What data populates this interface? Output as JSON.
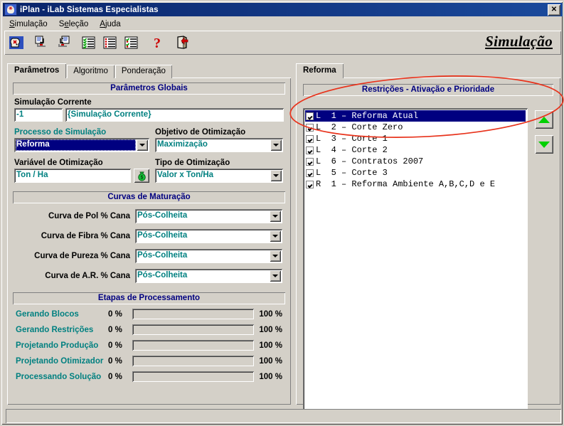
{
  "window": {
    "title": "iPlan - iLab Sistemas Especialistas",
    "icon": "app-head-icon",
    "close_label": "✕",
    "brand": "Simulação",
    "statusbar_text": ""
  },
  "menubar": {
    "items": [
      {
        "label": "Simulação",
        "accel": "S"
      },
      {
        "label": "Seleção",
        "accel": "e"
      },
      {
        "label": "Ajuda",
        "accel": "A"
      }
    ]
  },
  "toolbar": {
    "buttons": [
      {
        "name": "new-simulation-icon",
        "title": "Nova Simulação"
      },
      {
        "name": "import-icon",
        "title": "Importar"
      },
      {
        "name": "export-icon",
        "title": "Exportar"
      },
      {
        "name": "list-check-green-icon",
        "title": "Lista Ativada"
      },
      {
        "name": "list-bullets-icon",
        "title": "Lista"
      },
      {
        "name": "list-check-mixed-icon",
        "title": "Lista Mista"
      },
      {
        "name": "help-question-icon",
        "title": "Ajuda"
      },
      {
        "name": "exit-door-icon",
        "title": "Sair"
      }
    ]
  },
  "left": {
    "tabs": [
      {
        "label": "Parâmetros",
        "active": true
      },
      {
        "label": "Algoritmo",
        "active": false
      },
      {
        "label": "Ponderação",
        "active": false
      }
    ],
    "group_globais": "Parâmetros Globais",
    "simulacao_corrente_label": "Simulação Corrente",
    "simulacao_corrente_id": "-1",
    "simulacao_corrente_nome": "{Simulação Corrente}",
    "processo_label": "Processo de Simulação",
    "processo_value": "Reforma",
    "objetivo_label": "Objetivo de Otimização",
    "objetivo_value": "Maximização",
    "variavel_label": "Variável de Otimização",
    "variavel_value": "Ton / Ha",
    "variavel_icon": "money-bag-icon",
    "tipo_label": "Tipo de Otimização",
    "tipo_value": "Valor x Ton/Ha",
    "group_curvas": "Curvas de Maturação",
    "curvas": [
      {
        "label": "Curva de Pol % Cana",
        "value": "Pós-Colheita"
      },
      {
        "label": "Curva de Fibra % Cana",
        "value": "Pós-Colheita"
      },
      {
        "label": "Curva de Pureza % Cana",
        "value": "Pós-Colheita"
      },
      {
        "label": "Curva de A.R. % Cana",
        "value": "Pós-Colheita"
      }
    ],
    "group_etapas": "Etapas de Processamento",
    "etapas": [
      {
        "label": "Gerando Blocos",
        "min": "0 %",
        "max": "100 %",
        "progress": 0
      },
      {
        "label": "Gerando Restrições",
        "min": "0 %",
        "max": "100 %",
        "progress": 0
      },
      {
        "label": "Projetando Produção",
        "min": "0 %",
        "max": "100 %",
        "progress": 0
      },
      {
        "label": "Projetando Otimizador",
        "min": "0 %",
        "max": "100 %",
        "progress": 0
      },
      {
        "label": "Processando Solução",
        "min": "0 %",
        "max": "100 %",
        "progress": 0
      }
    ]
  },
  "right": {
    "tabs": [
      {
        "label": "Reforma",
        "active": true
      }
    ],
    "group_restricoes": "Restrições - Ativação e Prioridade",
    "restricoes": [
      {
        "checked": true,
        "tipo": "L",
        "num": "1",
        "nome": "Reforma Atual",
        "selected": true
      },
      {
        "checked": true,
        "tipo": "L",
        "num": "2",
        "nome": "Corte Zero",
        "selected": false
      },
      {
        "checked": true,
        "tipo": "L",
        "num": "3",
        "nome": "Corte 1",
        "selected": false
      },
      {
        "checked": true,
        "tipo": "L",
        "num": "4",
        "nome": "Corte 2",
        "selected": false
      },
      {
        "checked": true,
        "tipo": "L",
        "num": "6",
        "nome": "Contratos 2007",
        "selected": false
      },
      {
        "checked": true,
        "tipo": "L",
        "num": "5",
        "nome": "Corte 3",
        "selected": false
      },
      {
        "checked": true,
        "tipo": "R",
        "num": "1",
        "nome": "Reforma Ambiente A,B,C,D e E",
        "selected": false
      }
    ],
    "move_up_icon": "triangle-up-icon",
    "move_down_icon": "triangle-down-icon"
  },
  "annotation": {
    "shape": "red-ellipse-highlight",
    "color": "#e8331c"
  },
  "colors": {
    "titlebar": "#0a246a",
    "face": "#d4d0c8",
    "group_header_text": "#000080",
    "field_text": "#008080",
    "selection": "#000080",
    "accent_green": "#00d000",
    "annotation_red": "#e8331c"
  }
}
